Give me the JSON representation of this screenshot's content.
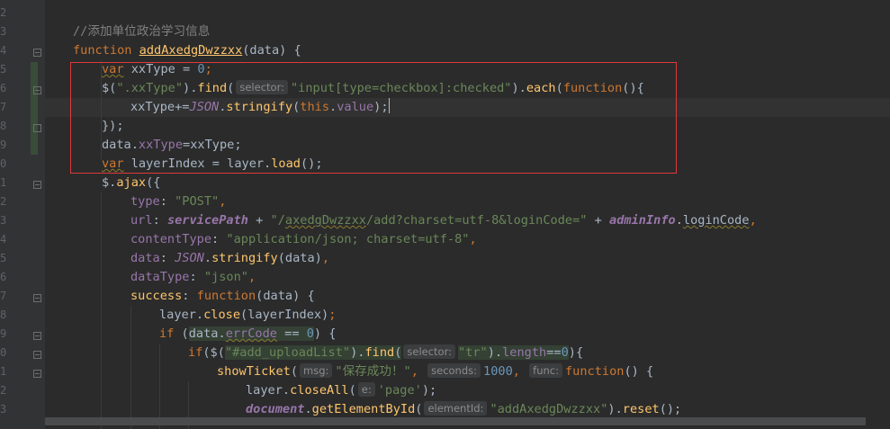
{
  "line_numbers": [
    "2",
    "3",
    "4",
    "5",
    "6",
    "7",
    "8",
    "9",
    "0",
    "1",
    "2",
    "3",
    "4",
    "5",
    "6",
    "7",
    "8",
    "9",
    "0",
    "1",
    "2",
    "3"
  ],
  "code": {
    "comment": "//添加单位政治学习信息",
    "l4_function": "function",
    "l4_name": "addAxedgDwzzxx",
    "l4_params": "(data) {",
    "l5_var": "var",
    "l5_rest": " xxType = ",
    "l5_num": "0",
    "l5_end": ";",
    "l6_dollar": "$(",
    "l6_sel": "\".xxType\"",
    "l6_dot": ").",
    "l6_find": "find",
    "l6_paren": "(",
    "l6_hint": "selector:",
    "l6_arg": "\"input[type=checkbox]:checked\"",
    "l6_dot2": ").",
    "l6_each": "each",
    "l6_paren2": "(",
    "l6_function": "function",
    "l6_end": "(){",
    "l7_a": "xxType+=",
    "l7_json": "JSON",
    "l7_dot": ".",
    "l7_stringify": "stringify",
    "l7_paren": "(",
    "l7_this": "this",
    "l7_dot2": ".",
    "l7_value": "value",
    "l7_end": ");",
    "l8_text": "});",
    "l9_a": "data.",
    "l9_prop": "xxType",
    "l9_b": "=xxType;",
    "l10_var": "var",
    "l10_a": " layerIndex = layer.",
    "l10_load": "load",
    "l10_b": "();",
    "l11_a": "$.",
    "l11_ajax": "ajax",
    "l11_b": "({",
    "l12_key": "type",
    "l12_colon": ": ",
    "l12_val": "\"POST\"",
    "l12_comma": ",",
    "l13_key": "url",
    "l13_colon": ": ",
    "l13_sp": "servicePath",
    "l13_plus": " + ",
    "l13_s1": "\"/",
    "l13_s2": "axedgDwzzxx",
    "l13_s3": "/add?charset=utf-8&loginCode=\"",
    "l13_plus2": " + ",
    "l13_admin": "adminInfo",
    "l13_dot": ".",
    "l13_lc": "loginCode",
    "l13_comma": ",",
    "l14_key": "contentType",
    "l14_colon": ": ",
    "l14_val": "\"application/json; charset=utf-8\"",
    "l14_comma": ",",
    "l15_key": "data",
    "l15_colon": ": ",
    "l15_json": "JSON",
    "l15_dot": ".",
    "l15_stringify": "stringify",
    "l15_rest": "(data)",
    "l15_comma": ",",
    "l16_key": "dataType",
    "l16_colon": ": ",
    "l16_val": "\"json\"",
    "l16_comma": ",",
    "l17_key": "success",
    "l17_colon": ": ",
    "l17_function": "function",
    "l17_rest": "(data) {",
    "l18_a": "layer.",
    "l18_close": "close",
    "l18_b": "(layerIndex)",
    "l18_c": ";",
    "l19_if": "if",
    "l19_a": " (",
    "l19_data": "data",
    "l19_dot": ".",
    "l19_err": "errCode",
    "l19_eq": " == ",
    "l19_zero": "0",
    "l19_b": ") {",
    "l20_if": "if",
    "l20_a": "($(",
    "l20_sel": "\"#add_uploadList\"",
    "l20_dot": ").",
    "l20_find": "find",
    "l20_paren": "(",
    "l20_hint": "selector:",
    "l20_tr": "\"tr\"",
    "l20_dot2": ").",
    "l20_length": "length",
    "l20_eqeq": "==",
    "l20_zero": "0",
    "l20_b": "){",
    "l21_fn": "showTicket",
    "l21_paren": "(",
    "l21_hint1": "msg:",
    "l21_msg": "\"保存成功！\"",
    "l21_comma1": ",",
    "l21_hint2": "seconds:",
    "l21_sec": "1000",
    "l21_comma2": ",",
    "l21_hint3": "func:",
    "l21_function": "function",
    "l21_end": "() {",
    "l22_a": "layer.",
    "l22_fn": "closeAll",
    "l22_paren": "(",
    "l22_hint": "e:",
    "l22_val": "'page'",
    "l22_end": ");",
    "l23_doc": "document",
    "l23_dot": ".",
    "l23_fn": "getElementById",
    "l23_paren": "(",
    "l23_hint": "elementId:",
    "l23_val": "\"addAxedgDwzzxx\"",
    "l23_dot2": ").",
    "l23_reset": "reset",
    "l23_end": "();"
  },
  "colors": {
    "background": "#2b2b2b",
    "keyword": "#cc7832",
    "function": "#ffc66d",
    "string": "#6a8759",
    "number": "#6897bb",
    "property": "#9876aa",
    "comment": "#808080",
    "annotation_box": "#e0393c"
  }
}
